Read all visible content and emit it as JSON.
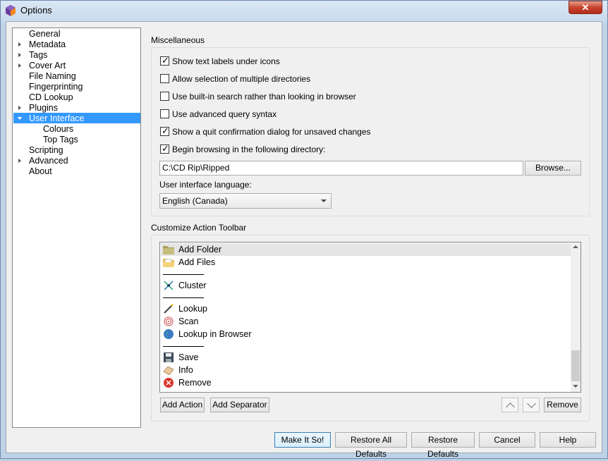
{
  "window": {
    "title": "Options",
    "close_label": "✕"
  },
  "sidebar": {
    "items": [
      {
        "label": "General"
      },
      {
        "label": "Metadata"
      },
      {
        "label": "Tags"
      },
      {
        "label": "Cover Art"
      },
      {
        "label": "File Naming"
      },
      {
        "label": "Fingerprinting"
      },
      {
        "label": "CD Lookup"
      },
      {
        "label": "Plugins"
      },
      {
        "label": "User Interface"
      },
      {
        "label": "Colours"
      },
      {
        "label": "Top Tags"
      },
      {
        "label": "Scripting"
      },
      {
        "label": "Advanced"
      },
      {
        "label": "About"
      }
    ],
    "selected": "User Interface"
  },
  "misc": {
    "title": "Miscellaneous",
    "options": [
      {
        "label": "Show text labels under icons",
        "checked": true
      },
      {
        "label": "Allow selection of multiple directories",
        "checked": false
      },
      {
        "label": "Use built-in search rather than looking in browser",
        "checked": false
      },
      {
        "label": "Use advanced query syntax",
        "checked": false
      },
      {
        "label": "Show a quit confirmation dialog for unsaved changes",
        "checked": true
      },
      {
        "label": "Begin browsing in the following directory:",
        "checked": true
      }
    ],
    "directory_value": "C:\\CD Rip\\Ripped",
    "browse_label": "Browse...",
    "language_label": "User interface language:",
    "language_value": "English (Canada)"
  },
  "toolbar": {
    "title": "Customize Action Toolbar",
    "actions": [
      {
        "label": "Add Folder",
        "icon": "folder-icon"
      },
      {
        "label": "Add Files",
        "icon": "files-icon"
      },
      {
        "label": "Cluster",
        "icon": "cluster-icon"
      },
      {
        "label": "Lookup",
        "icon": "wand-icon"
      },
      {
        "label": "Scan",
        "icon": "fingerprint-icon"
      },
      {
        "label": "Lookup in Browser",
        "icon": "globe-icon"
      },
      {
        "label": "Save",
        "icon": "floppy-icon"
      },
      {
        "label": "Info",
        "icon": "info-icon"
      },
      {
        "label": "Remove",
        "icon": "remove-icon"
      }
    ],
    "add_action_label": "Add Action",
    "add_separator_label": "Add Separator",
    "remove_label": "Remove"
  },
  "footer": {
    "make_it_so": "Make It So!",
    "restore_all": "Restore All Defaults",
    "restore": "Restore Defaults",
    "cancel": "Cancel",
    "help": "Help"
  },
  "colors": {
    "selection": "#3399ff",
    "close_red": "#c7432e"
  }
}
